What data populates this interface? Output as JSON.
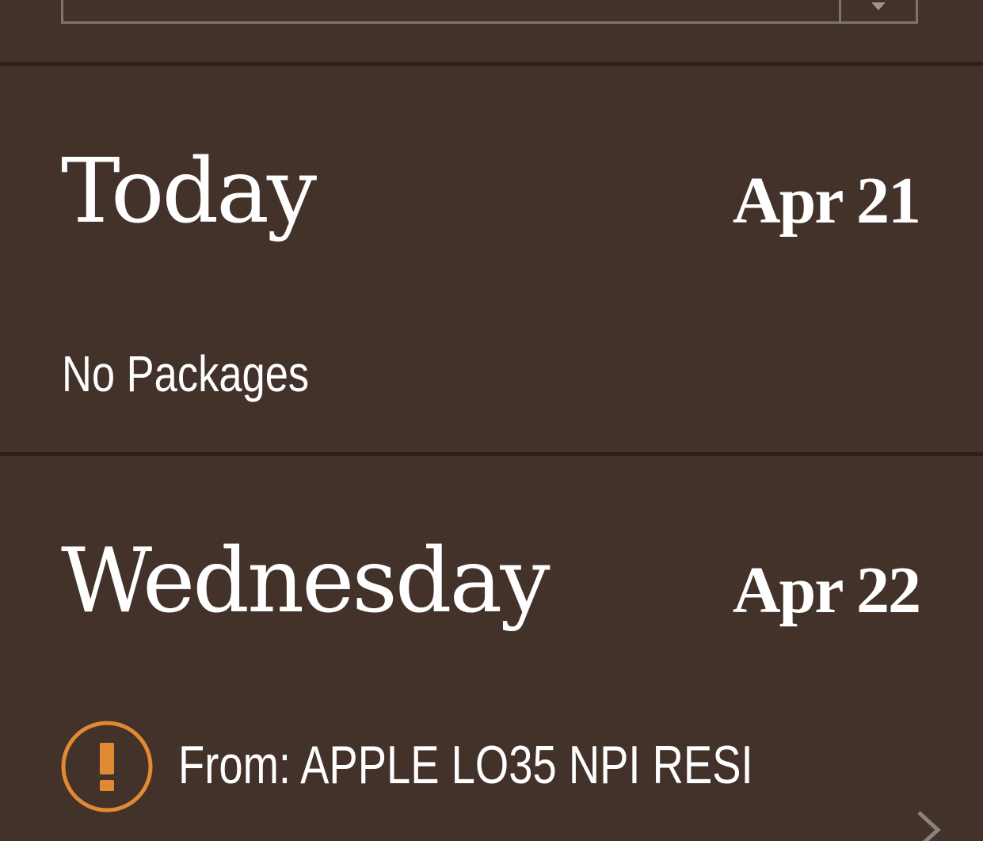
{
  "top_select": {
    "arrow_icon": "triangle-down-icon"
  },
  "days": [
    {
      "title": "Today",
      "date": "Apr 21",
      "empty_message": "No Packages"
    },
    {
      "title": "Wednesday",
      "date": "Apr 22",
      "packages": [
        {
          "from_label": "From: APPLE LO35 NPI RESI",
          "status_icon": "alert-icon",
          "status_color": "#e08a34",
          "chevron_icon": "chevron-right-icon"
        }
      ]
    }
  ],
  "colors": {
    "background": "#43322a",
    "divider": "#2c201b",
    "text": "#ffffff",
    "alert": "#e08a34"
  }
}
